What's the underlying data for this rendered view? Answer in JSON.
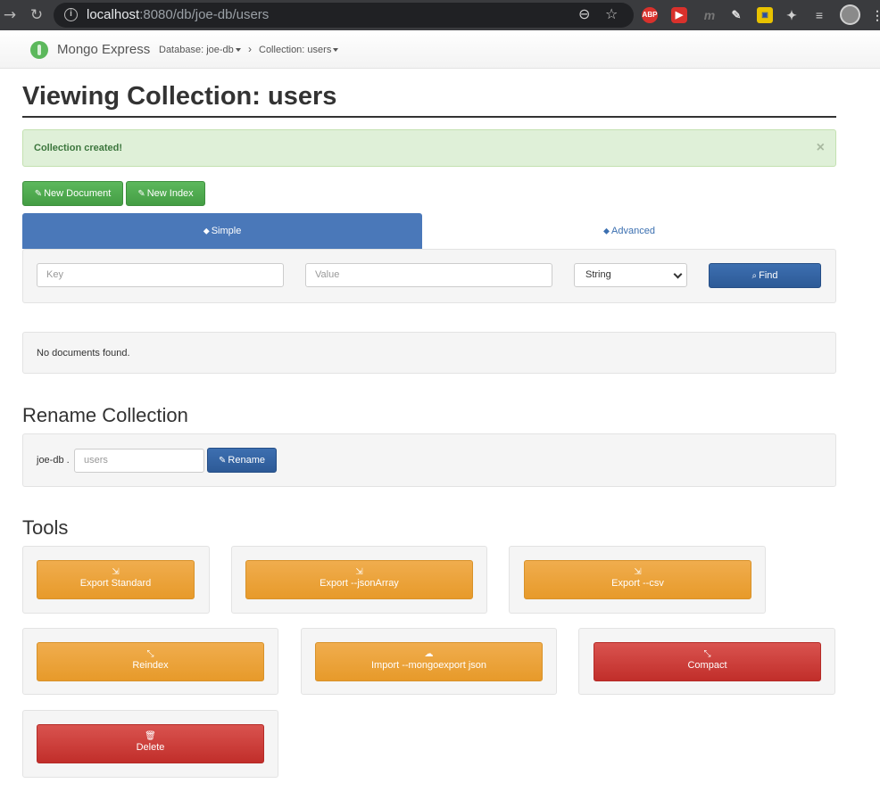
{
  "browser": {
    "url_host": "localhost",
    "url_path": ":8080/db/joe-db/users",
    "extensions": [
      "ABP",
      "▶",
      "m",
      "✎",
      "▣",
      "✦",
      "≡",
      "",
      "⋮"
    ]
  },
  "navbar": {
    "brand": "Mongo Express",
    "database_crumb": "Database: joe-db",
    "collection_crumb": "Collection: users"
  },
  "page": {
    "title": "Viewing Collection: users"
  },
  "alert": {
    "message": "Collection created!",
    "close": "×"
  },
  "actions": {
    "new_document": "New Document",
    "new_index": "New Index"
  },
  "search": {
    "tab_simple": "Simple",
    "tab_advanced": "Advanced",
    "key_placeholder": "Key",
    "value_placeholder": "Value",
    "type_selected": "String",
    "find_label": "Find"
  },
  "results": {
    "message": "No documents found."
  },
  "rename": {
    "title": "Rename Collection",
    "db_prefix": "joe-db .",
    "collection_placeholder": "users",
    "button": "Rename"
  },
  "tools": {
    "title": "Tools",
    "items": [
      {
        "label": "Export Standard",
        "icon": "⇲"
      },
      {
        "label": "Export --jsonArray",
        "icon": "⇲"
      },
      {
        "label": "Export --csv",
        "icon": "⇲"
      },
      {
        "label": "Reindex",
        "icon": "⤡"
      },
      {
        "label": "Import --mongoexport json",
        "icon": "☁"
      },
      {
        "label": "Compact",
        "icon": "⤡"
      },
      {
        "label": "Delete",
        "icon": "🗑"
      }
    ]
  },
  "colors": {
    "primary": "#4a78b9",
    "success": "#5cb85c",
    "warning": "#f0ad4e",
    "danger": "#d9534f"
  }
}
